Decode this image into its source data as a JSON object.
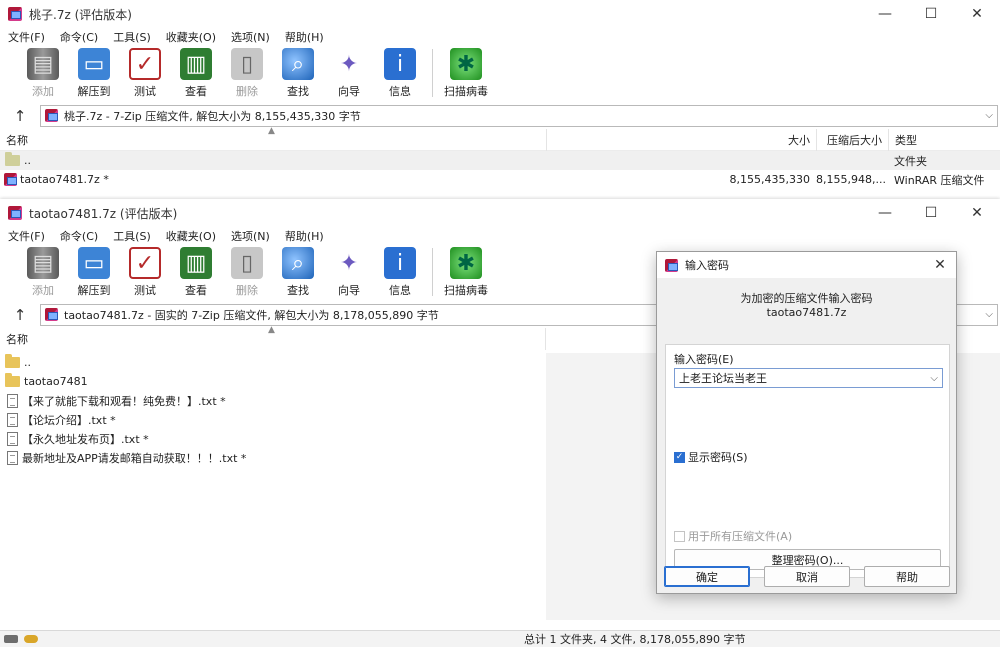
{
  "window1": {
    "title": "桃子.7z (评估版本)",
    "menu": [
      "文件(F)",
      "命令(C)",
      "工具(S)",
      "收藏夹(O)",
      "选项(N)",
      "帮助(H)"
    ],
    "toolbar": [
      {
        "label": "添加",
        "icon": "add-icon",
        "disabled": true
      },
      {
        "label": "解压到",
        "icon": "extract-folder-icon",
        "disabled": false
      },
      {
        "label": "测试",
        "icon": "test-icon",
        "disabled": false
      },
      {
        "label": "查看",
        "icon": "view-book-icon",
        "disabled": false
      },
      {
        "label": "删除",
        "icon": "trash-icon",
        "disabled": true
      },
      {
        "label": "查找",
        "icon": "magnifier-icon",
        "disabled": false
      },
      {
        "label": "向导",
        "icon": "wizard-wand-icon",
        "disabled": false
      },
      {
        "label": "信息",
        "icon": "info-icon",
        "disabled": false
      },
      {
        "label": "扫描病毒",
        "icon": "virus-scan-icon",
        "disabled": false
      }
    ],
    "address": "桃子.7z - 7-Zip 压缩文件, 解包大小为 8,155,435,330 字节",
    "columns": {
      "name": "名称",
      "size": "大小",
      "packed": "压缩后大小",
      "type": "类型"
    },
    "rows": [
      {
        "name": "..",
        "size": "",
        "packed": "",
        "type": "文件夹"
      },
      {
        "name": "taotao7481.7z *",
        "size": "8,155,435,330",
        "packed": "8,155,948,...",
        "type": "WinRAR 压缩文件"
      }
    ]
  },
  "window2": {
    "title": "taotao7481.7z (评估版本)",
    "menu": [
      "文件(F)",
      "命令(C)",
      "工具(S)",
      "收藏夹(O)",
      "选项(N)",
      "帮助(H)"
    ],
    "toolbar": [
      {
        "label": "添加",
        "icon": "add-icon",
        "disabled": true
      },
      {
        "label": "解压到",
        "icon": "extract-folder-icon",
        "disabled": false
      },
      {
        "label": "测试",
        "icon": "test-icon",
        "disabled": false
      },
      {
        "label": "查看",
        "icon": "view-book-icon",
        "disabled": false
      },
      {
        "label": "删除",
        "icon": "trash-icon",
        "disabled": true
      },
      {
        "label": "查找",
        "icon": "magnifier-icon",
        "disabled": false
      },
      {
        "label": "向导",
        "icon": "wizard-wand-icon",
        "disabled": false
      },
      {
        "label": "信息",
        "icon": "info-icon",
        "disabled": false
      },
      {
        "label": "扫描病毒",
        "icon": "virus-scan-icon",
        "disabled": false
      }
    ],
    "address": "taotao7481.7z - 固实的 7-Zip 压缩文件, 解包大小为 8,178,055,890 字节",
    "columns": {
      "name": "名称"
    },
    "rows": [
      {
        "name": "..",
        "kind": "folder"
      },
      {
        "name": "taotao7481",
        "kind": "folder"
      },
      {
        "name": "【来了就能下载和观看！纯免费！】.txt *",
        "kind": "txt"
      },
      {
        "name": "【论坛介绍】.txt *",
        "kind": "txt"
      },
      {
        "name": "【永久地址发布页】.txt *",
        "kind": "txt"
      },
      {
        "name": "最新地址及APP请发邮箱自动获取！！！.txt *",
        "kind": "txt"
      }
    ],
    "status": "总计 1 文件夹, 4 文件, 8,178,055,890 字节"
  },
  "dialog": {
    "title": "输入密码",
    "heading": "为加密的压缩文件输入密码",
    "archive": "taotao7481.7z",
    "password_label": "输入密码(E)",
    "password_value": "上老王论坛当老王",
    "show_password_label": "显示密码(S)",
    "show_password_checked": true,
    "use_all_label": "用于所有压缩文件(A)",
    "use_all_checked": false,
    "organize_label": "整理密码(O)...",
    "ok_label": "确定",
    "cancel_label": "取消",
    "help_label": "帮助"
  },
  "window_controls": {
    "minimize": "—",
    "maximize": "☐",
    "close": "✕"
  }
}
